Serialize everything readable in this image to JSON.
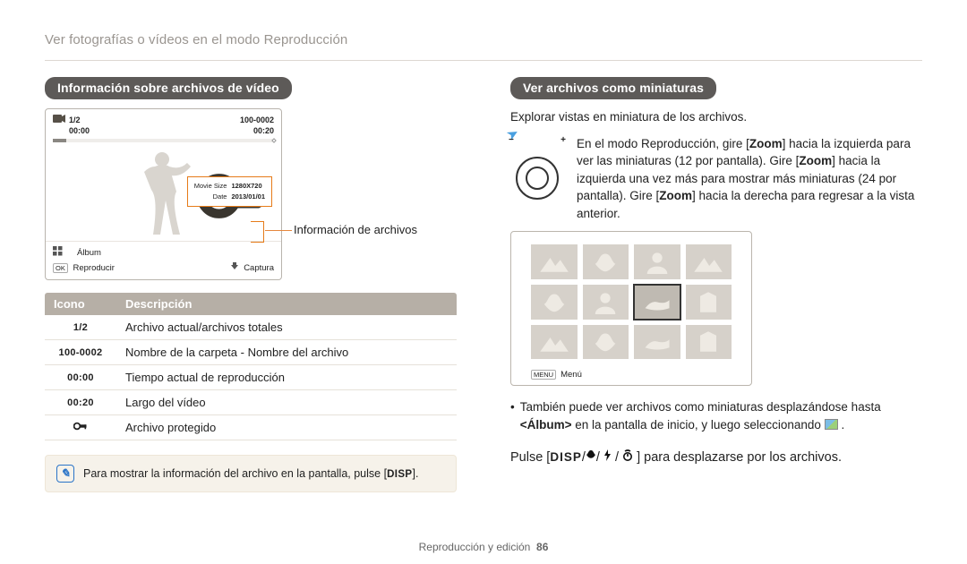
{
  "breadcrumb": "Ver fotografías o vídeos en el modo Reproducción",
  "left": {
    "heading": "Información sobre archivos de vídeo",
    "preview": {
      "counter": "1/2",
      "time_current": "00:00",
      "folder_file": "100-0002",
      "time_total": "00:20",
      "info_rows": [
        {
          "k": "Movie Size",
          "v": "1280X720"
        },
        {
          "k": "Date",
          "v": "2013/01/01"
        }
      ],
      "album_label": "Álbum",
      "play_label": "Reproducir",
      "capture_label": "Captura",
      "ok_key": "OK"
    },
    "callout": "Información de archivos",
    "table": {
      "head_icon": "Icono",
      "head_desc": "Descripción",
      "rows": [
        {
          "icon": "1/2",
          "desc": "Archivo actual/archivos totales"
        },
        {
          "icon": "100-0002",
          "desc": "Nombre de la carpeta - Nombre del archivo"
        },
        {
          "icon": "00:00",
          "desc": "Tiempo actual de reproducción"
        },
        {
          "icon": "00:20",
          "desc": "Largo del vídeo"
        },
        {
          "icon": "🔑",
          "desc": "Archivo protegido",
          "is_key": true
        }
      ]
    },
    "note_prefix": "Para mostrar la información del archivo en la pantalla, pulse [",
    "note_disp": "DISP",
    "note_suffix": "]."
  },
  "right": {
    "heading": "Ver archivos como miniaturas",
    "intro": "Explorar vistas en miniatura de los archivos.",
    "zoom_text_parts": [
      "En el modo Reproducción, gire [",
      "Zoom",
      "] hacia la izquierda para ver las miniaturas (12 por pantalla). Gire [",
      "Zoom",
      "] hacia la izquierda una vez más para mostrar más miniaturas (24 por pantalla). Gire [",
      "Zoom",
      "] hacia la derecha para regresar a la vista anterior."
    ],
    "menu_key": "MENU",
    "menu_label": "Menú",
    "bullet_parts": [
      "También puede ver archivos como miniaturas desplazándose hasta ",
      "<Álbum>",
      " en la pantalla de inicio, y luego seleccionando "
    ],
    "pulse_prefix": "Pulse [",
    "pulse_disp": "DISP",
    "pulse_suffix": "] para desplazarse por los archivos."
  },
  "footer": {
    "section": "Reproducción y edición",
    "page": "86"
  }
}
